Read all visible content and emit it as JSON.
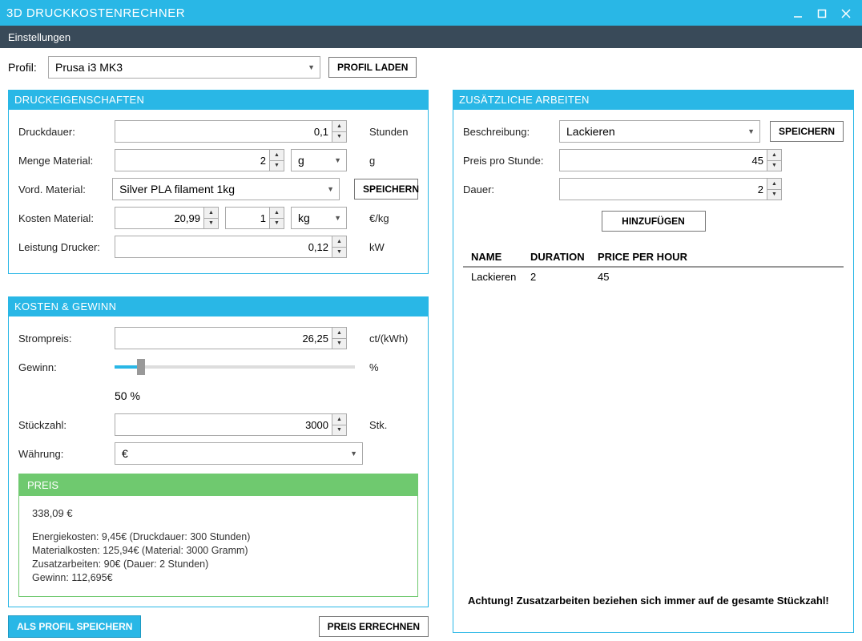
{
  "window": {
    "title": "3D DRUCKKOSTENRECHNER"
  },
  "subheader": {
    "label": "Einstellungen"
  },
  "profile": {
    "label": "Profil:",
    "selected": "Prusa i3 MK3",
    "load_btn": "PROFIL LADEN"
  },
  "panels": {
    "props": {
      "title": "DRUCKEIGENSCHAFTEN",
      "print_duration": {
        "label": "Druckdauer:",
        "value": "0,1",
        "unit": "Stunden"
      },
      "material_amount": {
        "label": "Menge Material:",
        "value": "2",
        "unit_select": "g",
        "unit": "g"
      },
      "material_preset": {
        "label": "Vord. Material:",
        "value": "Silver PLA filament 1kg",
        "save_btn": "SPEICHERN"
      },
      "material_cost": {
        "label": "Kosten Material:",
        "price": "20,99",
        "amount": "1",
        "unit_select": "kg",
        "unit": "€/kg"
      },
      "printer_power": {
        "label": "Leistung Drucker:",
        "value": "0,12",
        "unit": "kW"
      }
    },
    "cost": {
      "title": "KOSTEN & GEWINN",
      "power_price": {
        "label": "Strompreis:",
        "value": "26,25",
        "unit": "ct/(kWh)"
      },
      "profit": {
        "label": "Gewinn:",
        "percent_label": "50 %",
        "unit": "%"
      },
      "quantity": {
        "label": "Stückzahl:",
        "value": "3000",
        "unit": "Stk."
      },
      "currency": {
        "label": "Währung:",
        "value": "€"
      }
    },
    "price": {
      "title": "PREIS",
      "total": "338,09 €",
      "energy": "Energiekosten: 9,45€ (Druckdauer: 300 Stunden)",
      "material": "Materialkosten: 125,94€ (Material: 3000 Gramm)",
      "extra": "Zusatzarbeiten: 90€ (Dauer: 2 Stunden)",
      "profit": "Gewinn: 112,695€"
    },
    "extra": {
      "title": "ZUSÄTZLICHE ARBEITEN",
      "description": {
        "label": "Beschreibung:",
        "value": "Lackieren",
        "save_btn": "SPEICHERN"
      },
      "price_per_hour": {
        "label": "Preis pro Stunde:",
        "value": "45"
      },
      "duration": {
        "label": "Dauer:",
        "value": "2"
      },
      "add_btn": "HINZUFÜGEN",
      "table": {
        "headers": {
          "name": "NAME",
          "duration": "DURATION",
          "price": "PRICE PER HOUR"
        },
        "rows": [
          {
            "name": "Lackieren",
            "duration": "2",
            "price": "45"
          }
        ]
      },
      "warning": "Achtung! Zusatzarbeiten beziehen sich immer auf de gesamte Stückzahl!"
    }
  },
  "bottom": {
    "save_profile": "ALS PROFIL SPEICHERN",
    "calc": "PREIS ERRECHNEN"
  }
}
